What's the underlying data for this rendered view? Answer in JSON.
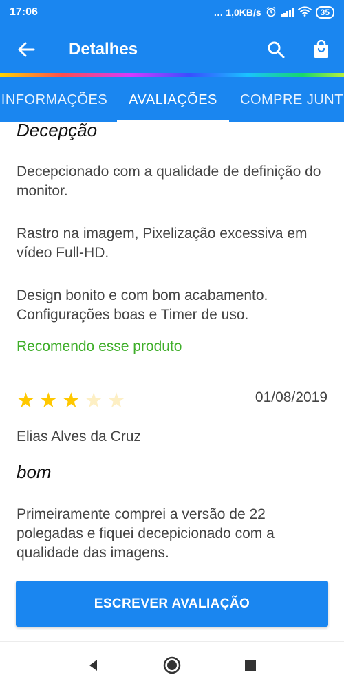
{
  "status_bar": {
    "time": "17:06",
    "net_speed": "… 1,0KB/s",
    "battery": "35"
  },
  "app_bar": {
    "title": "Detalhes",
    "back_icon": "arrow-left-icon",
    "search_icon": "search-icon",
    "cart_icon": "shopping-bag-icon"
  },
  "tabs": [
    {
      "label": "INFORMAÇÕES",
      "active": false
    },
    {
      "label": "AVALIAÇÕES",
      "active": true
    },
    {
      "label": "COMPRE JUNT",
      "active": false
    }
  ],
  "reviews": [
    {
      "title": "Decepção",
      "body_paragraphs": [
        "Decepcionado com a qualidade de definição do monitor.",
        "Rastro na imagem, Pixelização excessiva em vídeo Full-HD.",
        "Design bonito e com bom acabamento. Configurações boas e Timer de uso."
      ],
      "recommendation": "Recomendo esse produto"
    },
    {
      "rating": 3,
      "rating_max": 5,
      "date": "01/08/2019",
      "author": "Elias Alves da Cruz",
      "title": "bom",
      "body_paragraphs": [
        "Primeiramente comprei a versão de 22 polegadas e fiquei decepicionado com a qualidade das imagens."
      ]
    }
  ],
  "write_button_label": "ESCREVER AVALIAÇÃO",
  "colors": {
    "primary": "#1a86f0",
    "recommend_green": "#3fae2a",
    "star_on": "#ffc800",
    "star_off": "#fdefc4"
  }
}
